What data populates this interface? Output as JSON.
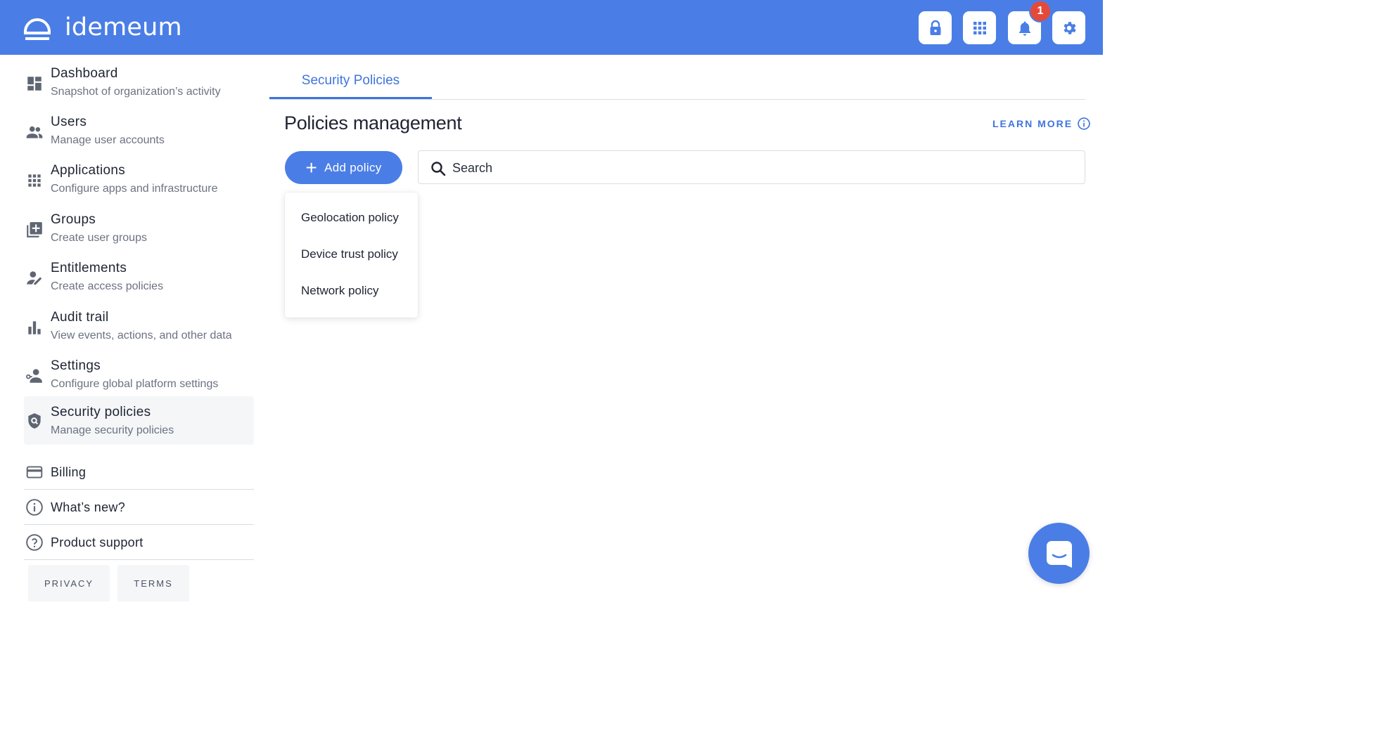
{
  "app": {
    "brand_name": "idemeum"
  },
  "header": {
    "notification_count": "1",
    "buttons": [
      {
        "icon": "lock-icon"
      },
      {
        "icon": "apps-grid-icon"
      },
      {
        "icon": "bell-icon"
      },
      {
        "icon": "gear-icon"
      }
    ]
  },
  "sidebar": {
    "items": [
      {
        "title": "Dashboard",
        "subtitle": "Snapshot of organization’s activity",
        "icon": "dashboard-icon"
      },
      {
        "title": "Users",
        "subtitle": "Manage user accounts",
        "icon": "users-icon"
      },
      {
        "title": "Applications",
        "subtitle": "Configure apps and infrastructure",
        "icon": "apps-grid-icon"
      },
      {
        "title": "Groups",
        "subtitle": "Create user groups",
        "icon": "add-group-icon"
      },
      {
        "title": "Entitlements",
        "subtitle": "Create access policies",
        "icon": "user-edit-icon"
      },
      {
        "title": "Audit trail",
        "subtitle": "View events, actions, and other data",
        "icon": "bar-chart-icon"
      },
      {
        "title": "Settings",
        "subtitle": "Configure global platform settings",
        "icon": "user-settings-icon"
      },
      {
        "title": "Security policies",
        "subtitle": "Manage security policies",
        "icon": "shield-search-icon",
        "active": true
      }
    ],
    "links": [
      {
        "title": "Billing",
        "icon": "credit-card-icon"
      },
      {
        "title": "What’s new?",
        "icon": "info-icon"
      },
      {
        "title": "Product support",
        "icon": "help-icon"
      }
    ],
    "footer": {
      "privacy": "PRIVACY",
      "terms": "TERMS"
    }
  },
  "main": {
    "tab": "Security Policies",
    "title": "Policies management",
    "learn_more": "LEARN MORE",
    "add_button": "Add policy",
    "search_placeholder": "Search",
    "dropdown": [
      "Geolocation policy",
      "Device trust policy",
      "Network policy"
    ]
  },
  "colors": {
    "brand": "#4a7ee6",
    "accent": "#3f74dd",
    "badge": "#e5493a"
  }
}
